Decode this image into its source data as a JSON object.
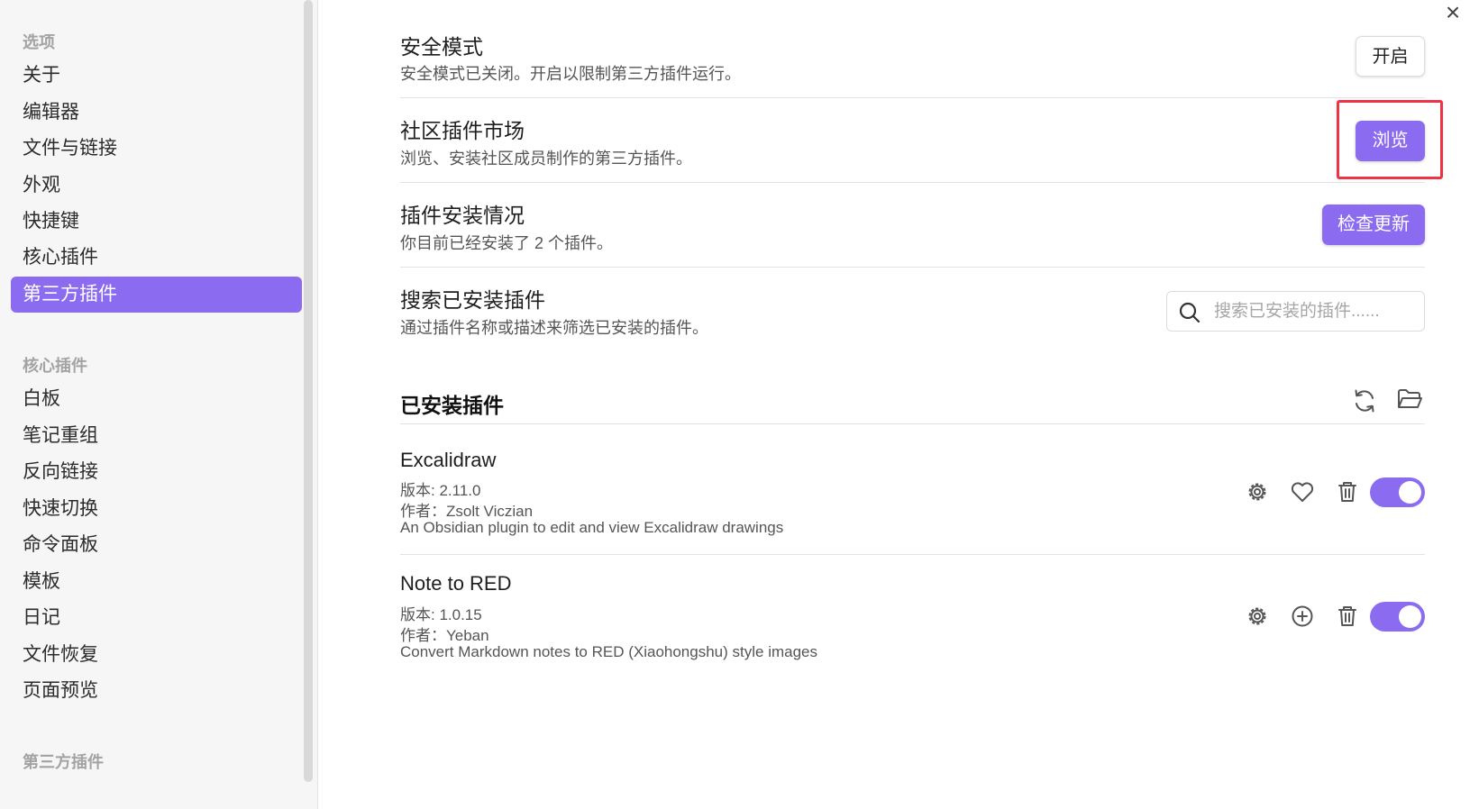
{
  "sidebar": {
    "heading_options": "选项",
    "options": [
      "关于",
      "编辑器",
      "文件与链接",
      "外观",
      "快捷键",
      "核心插件",
      "第三方插件"
    ],
    "active_option": "第三方插件",
    "heading_core": "核心插件",
    "core_plugins": [
      "白板",
      "笔记重组",
      "反向链接",
      "快速切换",
      "命令面板",
      "模板",
      "日记",
      "文件恢复",
      "页面预览"
    ],
    "heading_third_party": "第三方插件"
  },
  "close": {
    "icon": "close-icon",
    "label": "×"
  },
  "safe_mode": {
    "title": "安全模式",
    "desc": "安全模式已关闭。开启以限制第三方插件运行。",
    "button": "开启"
  },
  "community": {
    "title": "社区插件市场",
    "desc": "浏览、安装社区成员制作的第三方插件。",
    "button": "浏览"
  },
  "install_status": {
    "title": "插件安装情况",
    "desc": "你目前已经安装了 2 个插件。",
    "button": "检查更新"
  },
  "search": {
    "title": "搜索已安装插件",
    "desc": "通过插件名称或描述来筛选已安装的插件。",
    "placeholder": "搜索已安装的插件......"
  },
  "installed": {
    "title": "已安装插件",
    "plugins": [
      {
        "name": "Excalidraw",
        "version": "版本: 2.11.0",
        "author": "作者：Zsolt Viczian",
        "description": "An Obsidian plugin to edit and view Excalidraw drawings",
        "enabled": true,
        "middle_icon": "heart-icon"
      },
      {
        "name": "Note to RED",
        "version": "版本: 1.0.15",
        "author": "作者：Yeban",
        "description": "Convert Markdown notes to RED (Xiaohongshu) style images",
        "enabled": true,
        "middle_icon": "plus-circle-icon"
      }
    ]
  },
  "colors": {
    "accent": "#8b6cf0",
    "highlight": "#ee3344"
  }
}
